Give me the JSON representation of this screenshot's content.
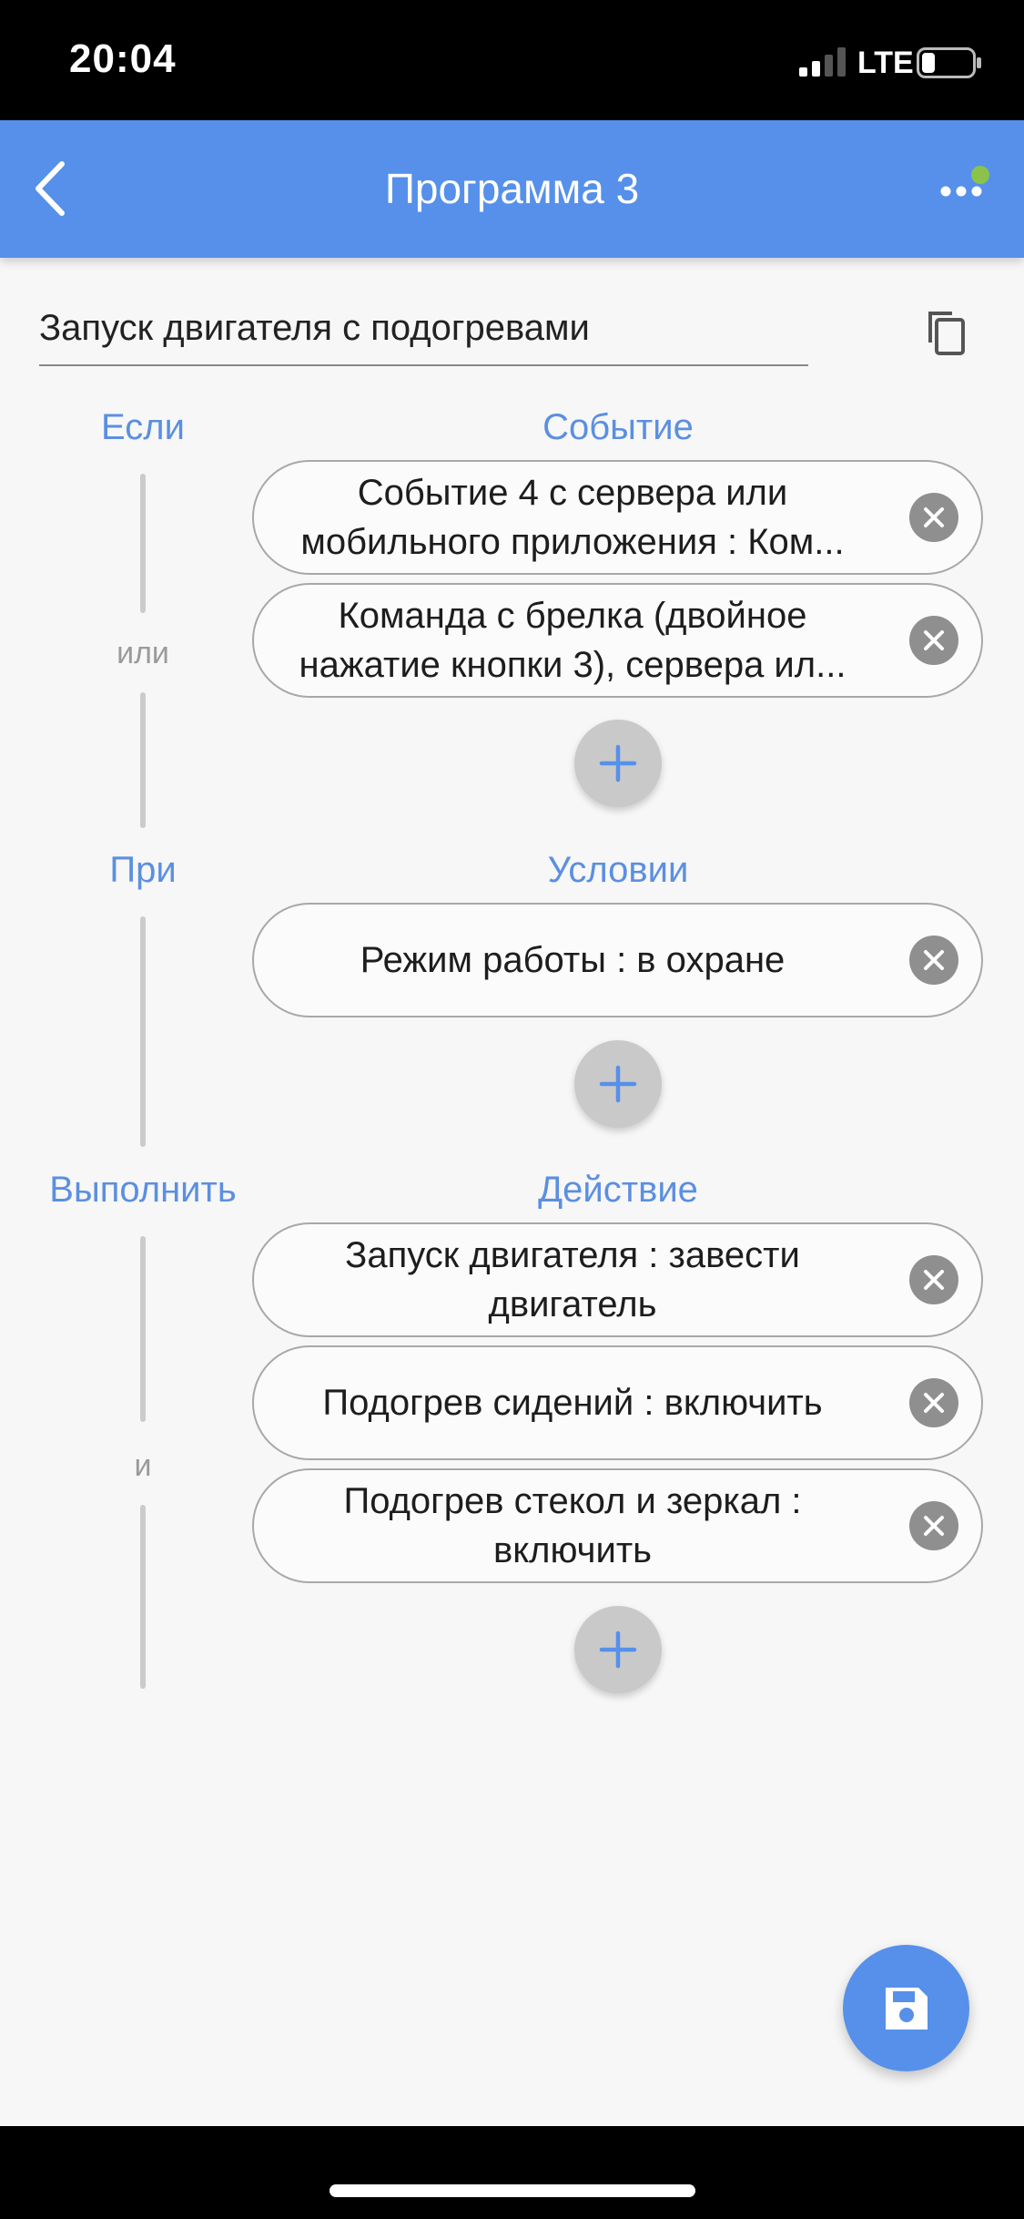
{
  "status_bar": {
    "time": "20:04",
    "network": "LTE",
    "signal_icon": "signal-icon",
    "battery_icon": "battery-icon"
  },
  "app_bar": {
    "title": "Программа 3",
    "back_icon": "back-arrow-icon",
    "menu_icon": "more-dots-icon",
    "status_dot_color": "#8bc34a",
    "color": "#5690ea"
  },
  "program_name": {
    "value": "Запуск двигателя с подогревами",
    "copy_icon": "copy-icon"
  },
  "events": {
    "left_label": "Если",
    "right_label": "Событие",
    "connector": "или",
    "items": [
      {
        "text": "Событие  4 с сервера или мобильного приложения : Ком..."
      },
      {
        "text": "Команда с брелка (двойное нажатие кнопки 3), сервера ил..."
      }
    ]
  },
  "conditions": {
    "left_label": "При",
    "right_label": "Условии",
    "items": [
      {
        "text": "Режим работы : в охране"
      }
    ]
  },
  "actions": {
    "left_label": "Выполнить",
    "right_label": "Действие",
    "connector": "и",
    "items": [
      {
        "text": "Запуск двигателя : завести двигатель"
      },
      {
        "text": "Подогрев сидений : включить"
      },
      {
        "text": "Подогрев стекол и зеркал : включить"
      }
    ]
  },
  "fab": {
    "icon": "save-icon"
  },
  "accent_color": "#5b8fe0"
}
